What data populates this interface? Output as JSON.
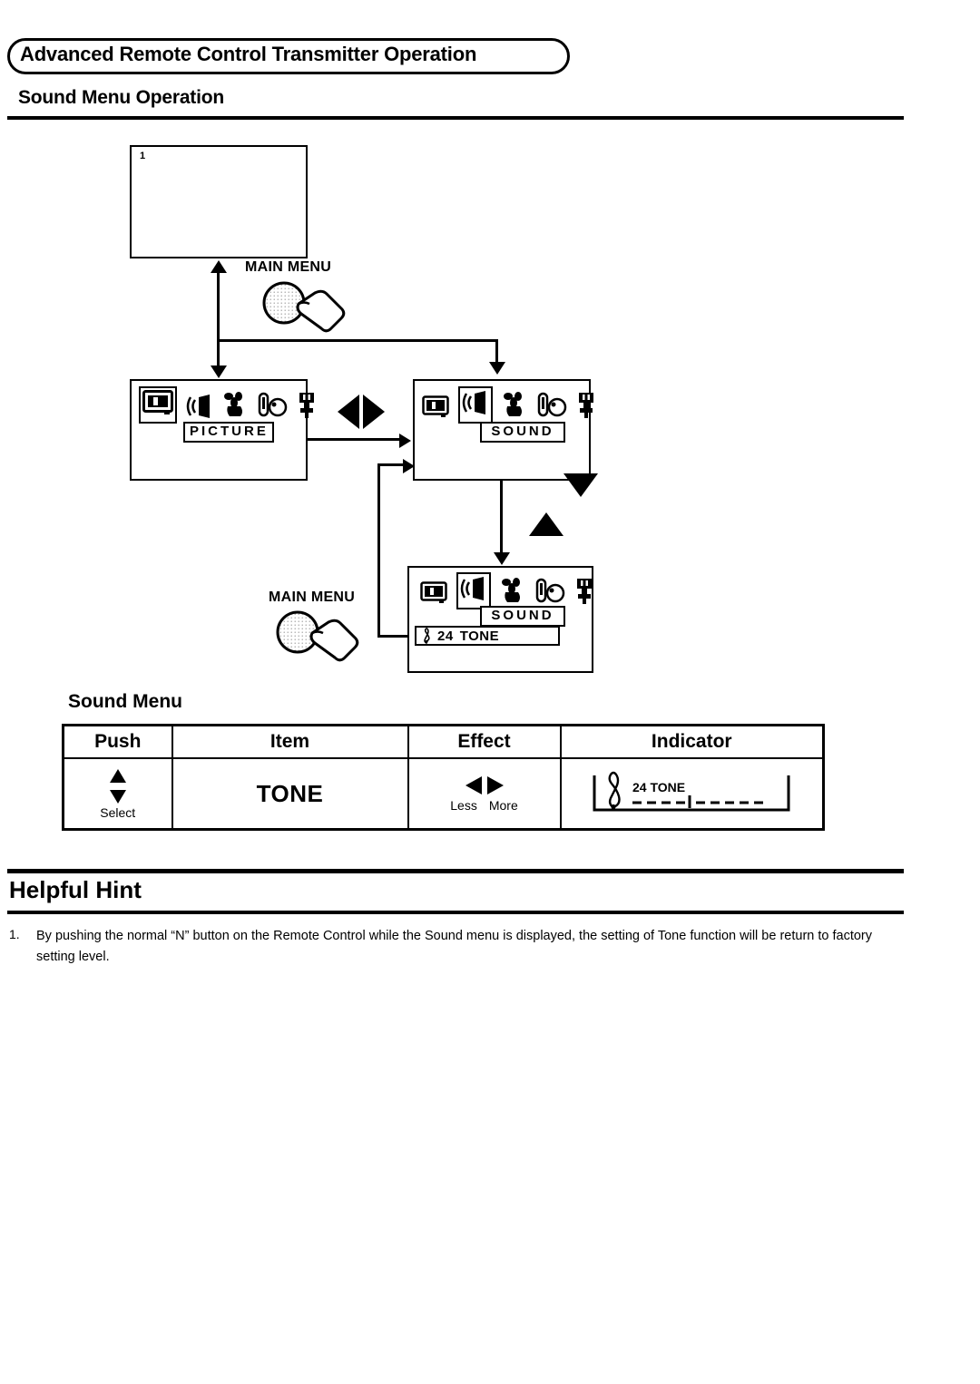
{
  "header": {
    "section_banner": "Advanced Remote Control Transmitter Operation",
    "page_subtitle": "Sound Menu Operation"
  },
  "diagram": {
    "screen1": {
      "number": "1"
    },
    "picture_menu": {
      "label": "PICTURE",
      "icons": [
        "picture-icon",
        "sound-icon",
        "timer-icon",
        "setup-icon",
        "plug-icon"
      ],
      "selected_index": 0
    },
    "sound_menu": {
      "label": "SOUND",
      "icons": [
        "picture-icon",
        "sound-icon",
        "timer-icon",
        "setup-icon",
        "plug-icon"
      ],
      "selected_index": 1
    },
    "sound_tone_menu": {
      "label": "SOUND",
      "icons": [
        "picture-icon",
        "sound-icon",
        "timer-icon",
        "setup-icon",
        "plug-icon"
      ],
      "selected_index": 1,
      "tone_row": {
        "clef": "treble-clef",
        "value": "24",
        "name": "TONE"
      }
    },
    "button_top": "MAIN MENU",
    "button_bottom": "MAIN MENU"
  },
  "sound_menu_table": {
    "title": "Sound Menu",
    "columns": [
      "Push",
      "Item",
      "Effect",
      "Indicator"
    ],
    "rows": [
      {
        "push": {
          "icon": "up-down-arrows-icon",
          "label": "Select"
        },
        "item": "TONE",
        "effect": {
          "icon": "left-right-arrows-icon",
          "left_label": "Less",
          "right_label": "More"
        },
        "indicator": {
          "clef": "treble-clef",
          "value": "24",
          "name": "TONE"
        }
      }
    ]
  },
  "helpful_hint": {
    "title": "Helpful Hint",
    "items": [
      {
        "number": "1.",
        "text": "By pushing the normal “N” button on the Remote Control while the Sound menu is displayed, the setting of Tone function will be return to factory setting level."
      }
    ]
  },
  "colors": {
    "ink": "#000000",
    "paper": "#ffffff"
  }
}
